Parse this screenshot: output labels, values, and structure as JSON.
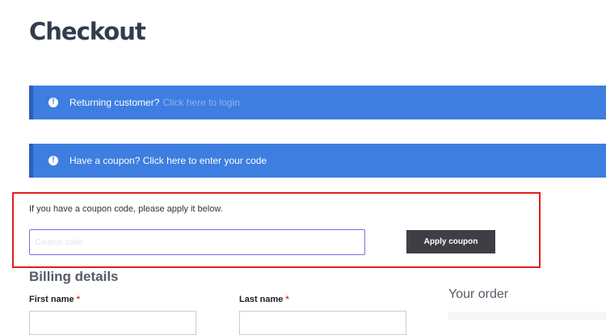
{
  "page": {
    "title": "Checkout"
  },
  "notices": {
    "returning": {
      "text": "Returning customer?",
      "link": "Click here to login",
      "icon": "info-icon"
    },
    "coupon": {
      "text": "Have a coupon? Click here to enter your code",
      "icon": "info-icon"
    }
  },
  "coupon_form": {
    "help_text": "If you have a coupon code, please apply it below.",
    "input_placeholder": "Coupon code",
    "apply_label": "Apply coupon"
  },
  "billing": {
    "heading": "Billing details",
    "first_name_label": "First name",
    "last_name_label": "Last name",
    "required_mark": "*"
  },
  "order": {
    "heading": "Your order"
  },
  "colors": {
    "notice_bg": "#3d7ee0",
    "highlight_border": "#e01e1e",
    "button_bg": "#3e3f44",
    "required": "#e2401c"
  }
}
